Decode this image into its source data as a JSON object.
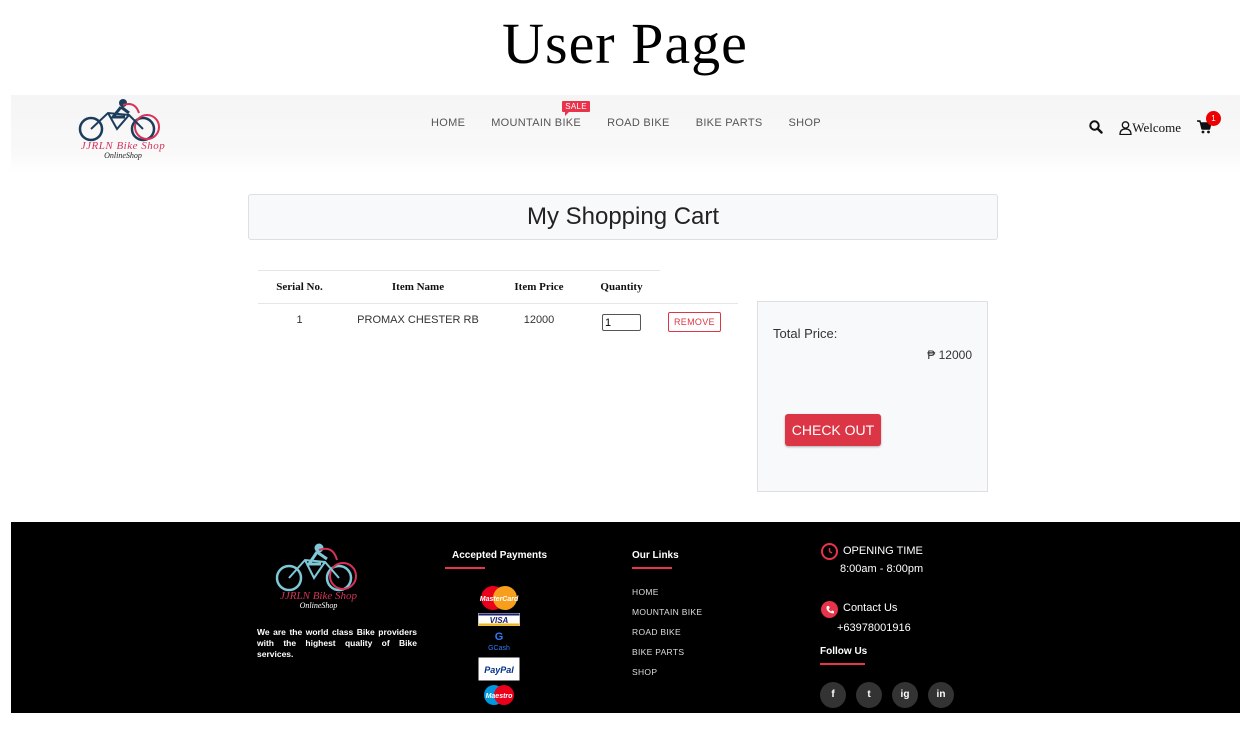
{
  "page_heading": "User Page",
  "brand": {
    "name": "JJRLN Bike Shop",
    "sub": "OnlineShop"
  },
  "nav": {
    "items": [
      "HOME",
      "MOUNTAIN BIKE",
      "ROAD BIKE",
      "BIKE PARTS",
      "SHOP"
    ],
    "sale_badge": "SALE",
    "welcome": "Welcome",
    "cart_count": "1"
  },
  "cart": {
    "title": "My Shopping Cart",
    "columns": [
      "Serial No.",
      "Item Name",
      "Item Price",
      "Quantity"
    ],
    "rows": [
      {
        "serial": "1",
        "name": "PROMAX CHESTER RB",
        "price": "12000",
        "quantity": "1",
        "remove": "REMOVE"
      }
    ],
    "total_label": "Total Price:",
    "total_value": "₱ 12000",
    "checkout": "CHECK OUT"
  },
  "footer": {
    "description": "We are the world class Bike providers with the highest quality of Bike services.",
    "payments_title": "Accepted Payments",
    "payments": [
      "MasterCard",
      "VISA",
      "GCash",
      "PayPal",
      "Maestro"
    ],
    "links_title": "Our Links",
    "links": [
      "HOME",
      "MOUNTAIN BIKE",
      "ROAD BIKE",
      "BIKE PARTS",
      "SHOP"
    ],
    "opening_title": "OPENING TIME",
    "opening_hours": "8:00am - 8:00pm",
    "contact_title": "Contact Us",
    "phone": "+63978001916",
    "follow_title": "Follow Us",
    "social": [
      "f",
      "t",
      "ig",
      "in"
    ]
  },
  "colors": {
    "accent": "#dc3545",
    "brand_pink": "#d6325a",
    "footer_bg": "#000000"
  }
}
